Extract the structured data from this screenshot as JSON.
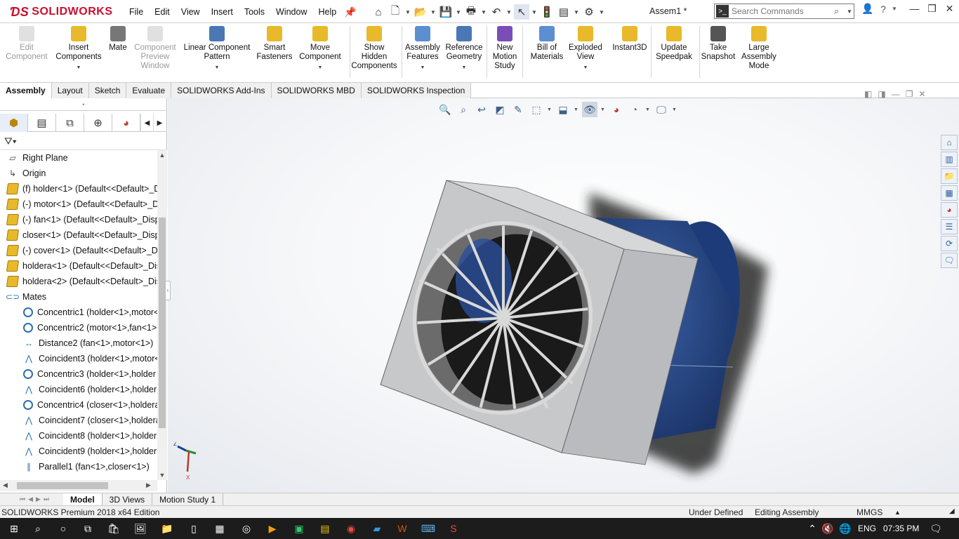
{
  "app": {
    "logo": "SOLIDWORKS",
    "document_title": "Assem1 *"
  },
  "menu": [
    "File",
    "Edit",
    "View",
    "Insert",
    "Tools",
    "Window",
    "Help"
  ],
  "search": {
    "placeholder": "Search Commands"
  },
  "commands": [
    {
      "label": "Edit\nComponent",
      "enabled": false
    },
    {
      "label": "Insert\nComponents",
      "enabled": true
    },
    {
      "label": "Mate",
      "enabled": true
    },
    {
      "label": "Component\nPreview\nWindow",
      "enabled": false
    },
    {
      "label": "Linear Component\nPattern",
      "enabled": true
    },
    {
      "label": "Smart\nFasteners",
      "enabled": true
    },
    {
      "label": "Move\nComponent",
      "enabled": true
    },
    {
      "label": "Show\nHidden\nComponents",
      "enabled": true
    },
    {
      "label": "Assembly\nFeatures",
      "enabled": true
    },
    {
      "label": "Reference\nGeometry",
      "enabled": true
    },
    {
      "label": "New\nMotion\nStudy",
      "enabled": true
    },
    {
      "label": "Bill of\nMaterials",
      "enabled": true
    },
    {
      "label": "Exploded\nView",
      "enabled": true
    },
    {
      "label": "Instant3D",
      "enabled": true
    },
    {
      "label": "Update\nSpeedpak",
      "enabled": true
    },
    {
      "label": "Take\nSnapshot",
      "enabled": true
    },
    {
      "label": "Large\nAssembly\nMode",
      "enabled": true
    }
  ],
  "command_tabs": [
    "Assembly",
    "Layout",
    "Sketch",
    "Evaluate",
    "SOLIDWORKS Add-Ins",
    "SOLIDWORKS MBD",
    "SOLIDWORKS Inspection"
  ],
  "active_command_tab": "Assembly",
  "tree": [
    {
      "label": "Right Plane",
      "type": "plane",
      "indent": 0
    },
    {
      "label": "Origin",
      "type": "origin",
      "indent": 0
    },
    {
      "label": "(f) holder<1> (Default<<Default>_D",
      "type": "part",
      "indent": 0
    },
    {
      "label": "(-) motor<1> (Default<<Default>_D",
      "type": "part",
      "indent": 0
    },
    {
      "label": "(-) fan<1> (Default<<Default>_Disp",
      "type": "part",
      "indent": 0
    },
    {
      "label": "closer<1> (Default<<Default>_Disp",
      "type": "part",
      "indent": 0
    },
    {
      "label": "(-) cover<1> (Default<<Default>_D",
      "type": "part",
      "indent": 0
    },
    {
      "label": "holdera<1> (Default<<Default>_Dis",
      "type": "part",
      "indent": 0
    },
    {
      "label": "holdera<2> (Default<<Default>_Dis",
      "type": "part",
      "indent": 0
    },
    {
      "label": "Mates",
      "type": "mates",
      "indent": 0
    },
    {
      "label": "Concentric1 (holder<1>,motor<",
      "type": "concentric",
      "indent": 1
    },
    {
      "label": "Concentric2 (motor<1>,fan<1>",
      "type": "concentric",
      "indent": 1
    },
    {
      "label": "Distance2 (fan<1>,motor<1>)",
      "type": "distance",
      "indent": 1
    },
    {
      "label": "Coincident3 (holder<1>,motor<",
      "type": "coincident",
      "indent": 1
    },
    {
      "label": "Concentric3 (holder<1>,holder",
      "type": "concentric",
      "indent": 1
    },
    {
      "label": "Coincident6 (holder<1>,holder",
      "type": "coincident",
      "indent": 1
    },
    {
      "label": "Concentric4 (closer<1>,holdera",
      "type": "concentric",
      "indent": 1
    },
    {
      "label": "Coincident7 (closer<1>,holdera",
      "type": "coincident",
      "indent": 1
    },
    {
      "label": "Coincident8 (holder<1>,holder",
      "type": "coincident",
      "indent": 1
    },
    {
      "label": "Coincident9 (holder<1>,holder",
      "type": "coincident",
      "indent": 1
    },
    {
      "label": "Parallel1 (fan<1>,closer<1>)",
      "type": "parallel",
      "indent": 1
    }
  ],
  "triad": {
    "axis_z": "Z",
    "axis_x": "X"
  },
  "bottom_tabs": [
    "Model",
    "3D Views",
    "Motion Study 1"
  ],
  "active_bottom_tab": "Model",
  "status": {
    "product": "SOLIDWORKS Premium 2018 x64 Edition",
    "definition": "Under Defined",
    "mode": "Editing Assembly",
    "units": "MMGS"
  },
  "taskbar": {
    "language": "ENG",
    "time": "07:35 PM"
  },
  "colors": {
    "brand_red": "#c8102e",
    "accent_blue": "#2e6ea8",
    "part_yellow": "#e8b92a",
    "motor_blue": "#1f3f7a",
    "fan_body_grey": "#c7c8ca"
  }
}
